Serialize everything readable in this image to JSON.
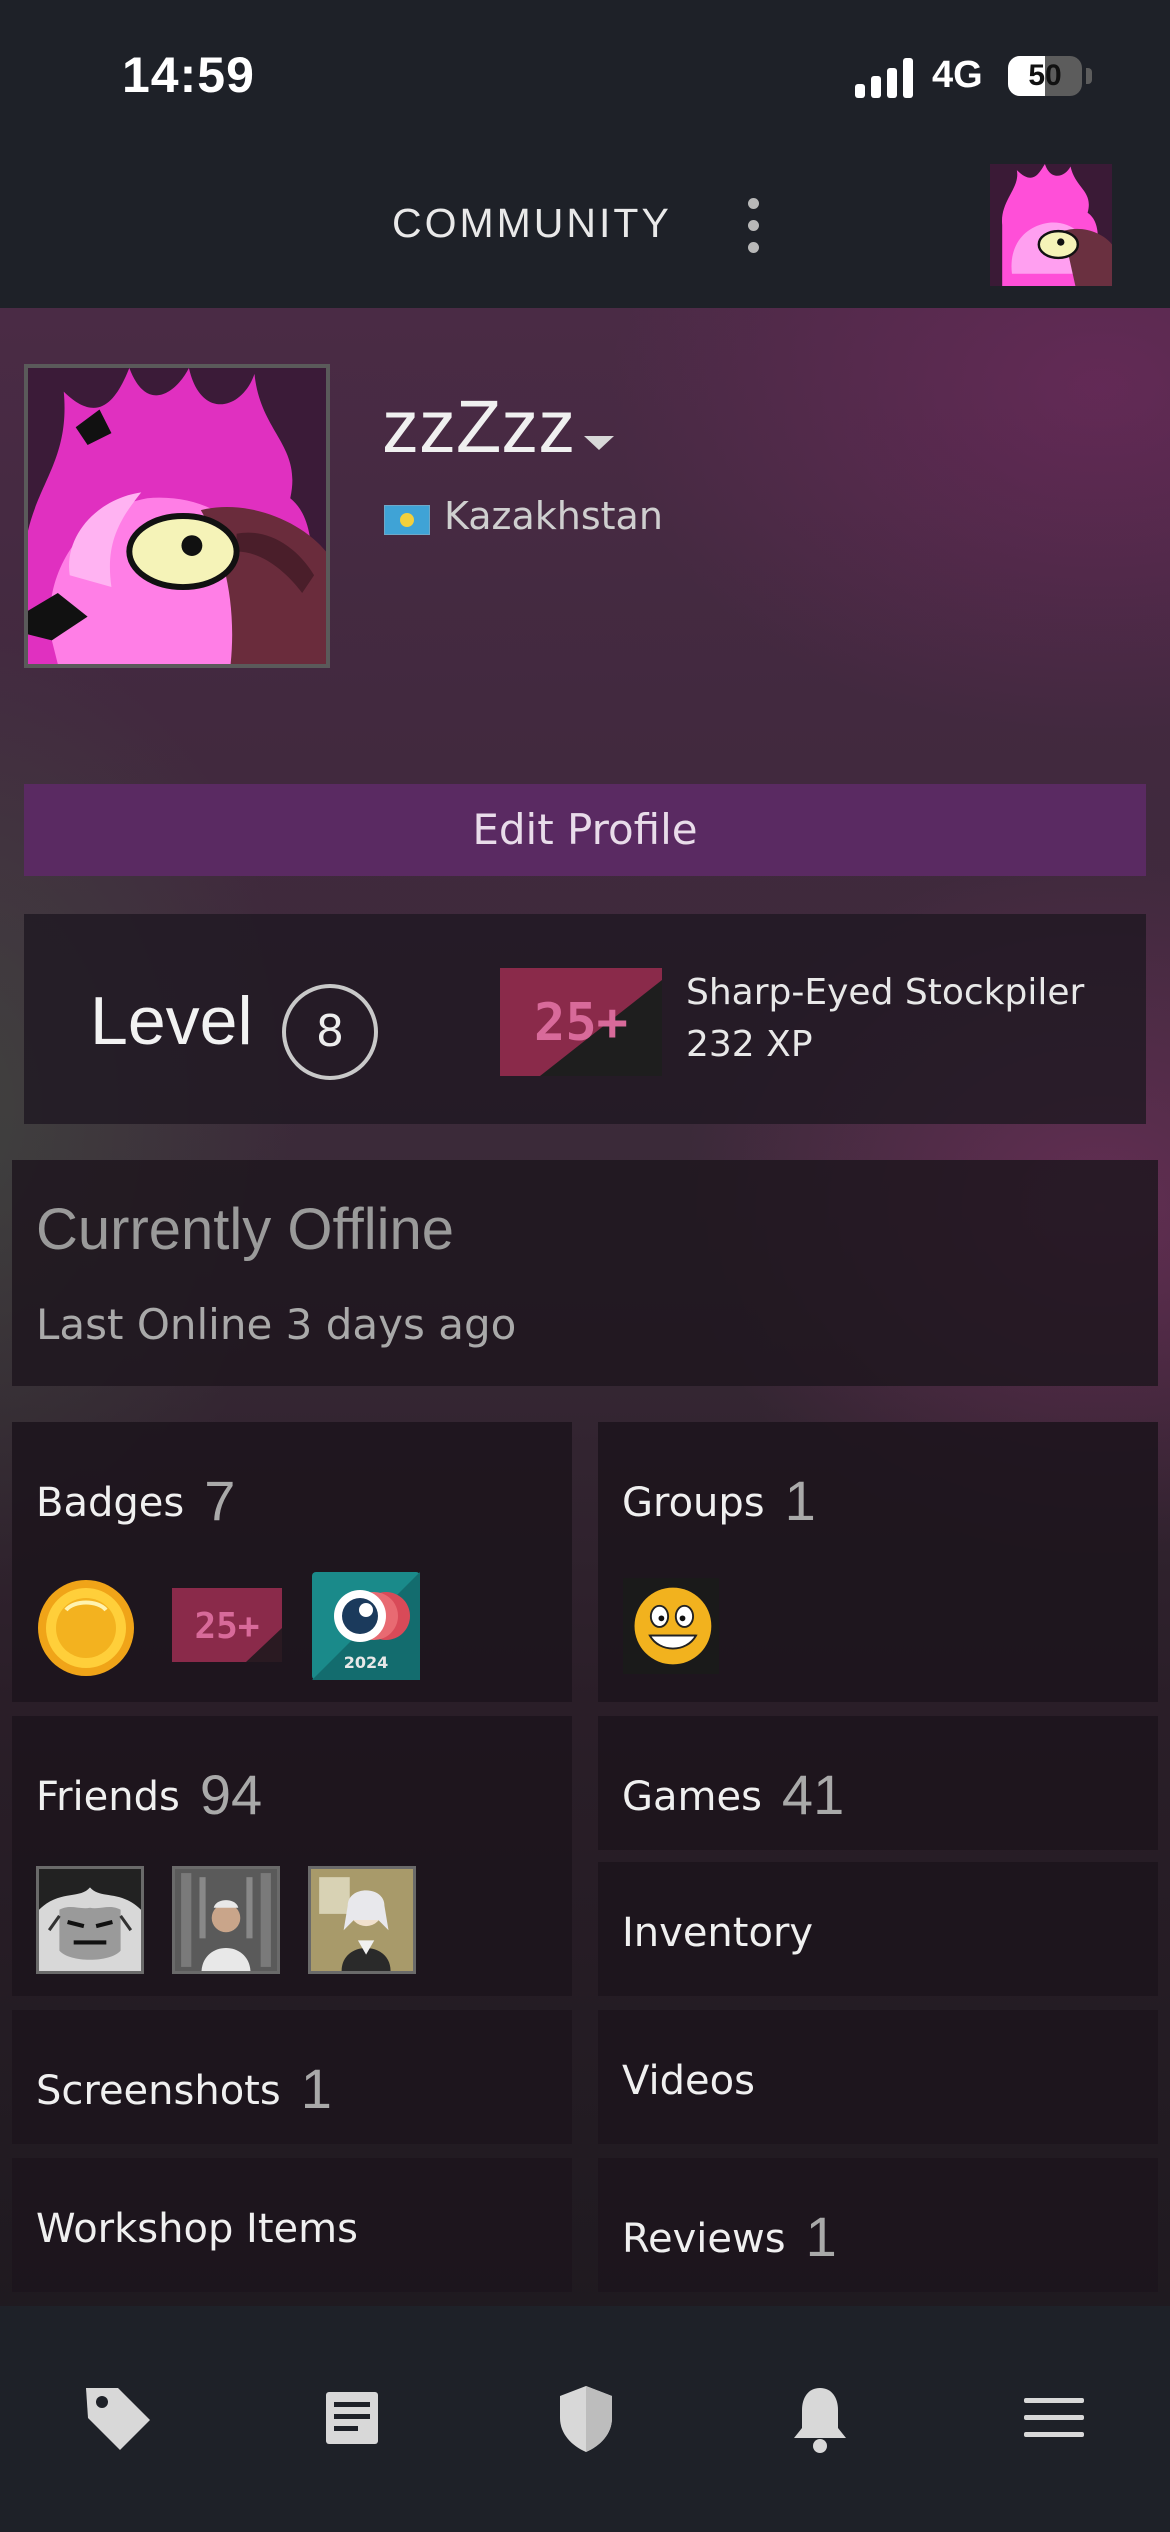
{
  "status_bar": {
    "time": "14:59",
    "network": "4G",
    "battery": "50"
  },
  "header": {
    "title": "COMMUNITY"
  },
  "profile": {
    "username": "zzZzz",
    "country": "Kazakhstan",
    "edit_profile_label": "Edit Profile"
  },
  "level": {
    "label": "Level",
    "value": "8",
    "badge_name": "Sharp-Eyed Stockpiler",
    "badge_xp": "232 XP",
    "badge_image_text": "25+"
  },
  "status": {
    "title": "Currently Offline",
    "last_online": "Last Online 3 days ago"
  },
  "tiles": {
    "badges": {
      "label": "Badges",
      "count": "7"
    },
    "groups": {
      "label": "Groups",
      "count": "1"
    },
    "friends": {
      "label": "Friends",
      "count": "94"
    },
    "games": {
      "label": "Games",
      "count": "41"
    },
    "inventory": {
      "label": "Inventory"
    },
    "screenshots": {
      "label": "Screenshots",
      "count": "1"
    },
    "videos": {
      "label": "Videos"
    },
    "workshop": {
      "label": "Workshop Items"
    },
    "reviews": {
      "label": "Reviews",
      "count": "1"
    }
  },
  "badge_icons": {
    "badge2_text": "25+",
    "badge3_text": "2024"
  },
  "bottom_nav": [
    "tag-icon",
    "news-icon",
    "shield-icon",
    "bell-icon",
    "menu-icon"
  ],
  "colors": {
    "background": "#1e2128",
    "edit_button": "#5a2a62",
    "accent_pink": "#e040c8"
  }
}
